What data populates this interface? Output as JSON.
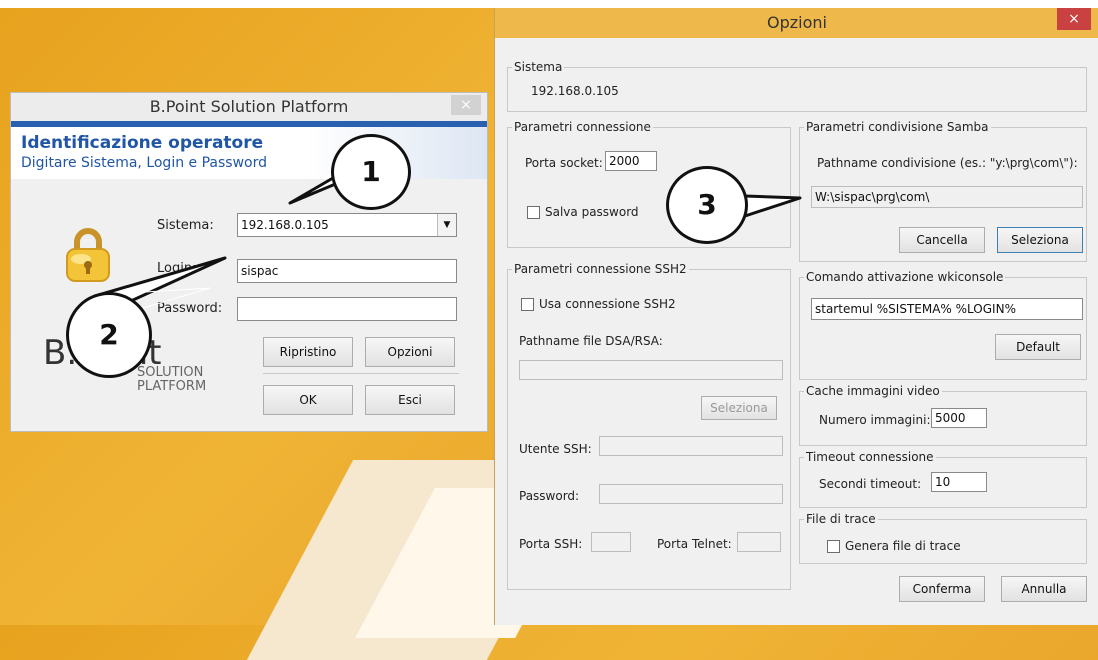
{
  "login_window": {
    "title": "B.Point Solution Platform",
    "close_glyph": "×",
    "banner_title": "Identificazione operatore",
    "banner_subtitle": "Digitare Sistema, Login e  Password",
    "sistema_label": "Sistema:",
    "sistema_value": "192.168.0.105",
    "login_label": "Login:",
    "login_value": "sispac",
    "password_label": "Password:",
    "password_value": "",
    "ripristino_label": "Ripristino",
    "opzioni_label": "Opzioni",
    "ok_label": "OK",
    "esci_label": "Esci",
    "logo_b": "B.",
    "logo_point": "Point",
    "logo_solution": "SOLUTION",
    "logo_platform": "PLATFORM",
    "icon": "padlock-icon"
  },
  "options_window": {
    "title": "Opzioni",
    "close_glyph": "×",
    "sistema": {
      "legend": "Sistema",
      "value": "192.168.0.105"
    },
    "parametri_connessione": {
      "legend": "Parametri connessione",
      "porta_label": "Porta socket:",
      "porta_value": "2000",
      "salva_label": "Salva password",
      "salva_checked": false
    },
    "samba": {
      "legend": "Parametri condivisione Samba",
      "pathname_label": "Pathname condivisione (es.: \"y:\\prg\\com\\\"):",
      "pathname_value": "W:\\sispac\\prg\\com\\",
      "cancella_label": "Cancella",
      "seleziona_label": "Seleziona"
    },
    "ssh": {
      "legend": "Parametri connessione SSH2",
      "usa_label": "Usa connessione SSH2",
      "usa_checked": false,
      "pathname_label": "Pathname file DSA/RSA:",
      "pathname_value": "",
      "seleziona_label": "Seleziona",
      "utente_label": "Utente SSH:",
      "password_label": "Password:",
      "porta_ssh_label": "Porta SSH:",
      "porta_telnet_label": "Porta Telnet:"
    },
    "wkiconsole": {
      "legend": "Comando attivazione wkiconsole",
      "value": "startemul %SISTEMA% %LOGIN%",
      "default_label": "Default"
    },
    "cache": {
      "legend": "Cache immagini video",
      "label": "Numero immagini:",
      "value": "5000"
    },
    "timeout": {
      "legend": "Timeout connessione",
      "label": "Secondi timeout:",
      "value": "10"
    },
    "trace": {
      "legend": "File di trace",
      "label": "Genera file di trace",
      "checked": false
    },
    "conferma_label": "Conferma",
    "annulla_label": "Annulla"
  },
  "callouts": [
    "1",
    "2",
    "3"
  ]
}
